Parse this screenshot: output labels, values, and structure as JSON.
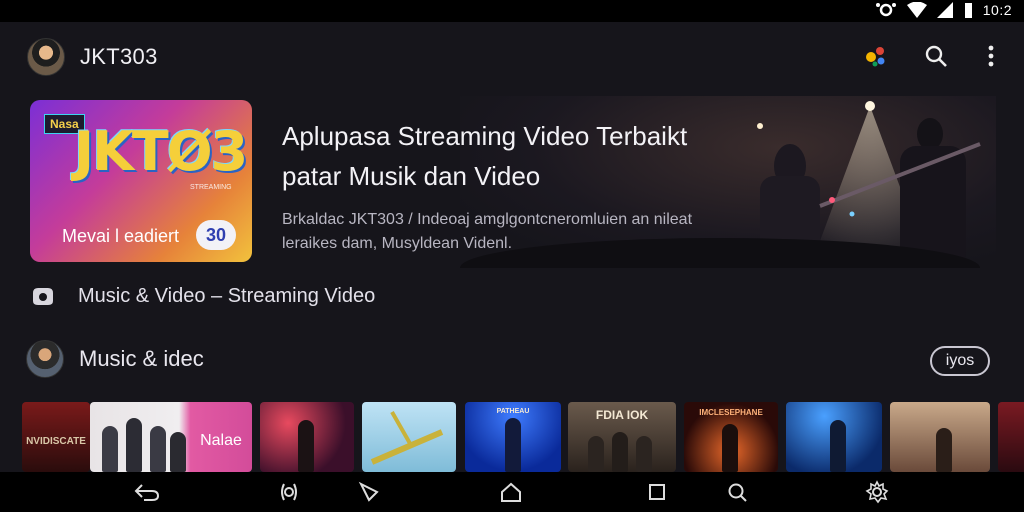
{
  "status_bar": {
    "time": "10:2",
    "icons": [
      "camera-icon",
      "wifi-icon",
      "cellular-icon",
      "battery-icon"
    ]
  },
  "header": {
    "title": "JKT303",
    "actions": [
      "assistant-icon",
      "search-icon",
      "more-vert-icon"
    ]
  },
  "hero": {
    "card_logo": "Nasa",
    "card_brand": "JKTØ3",
    "card_subtext": "STREAMING",
    "card_label": "Mevai l eadiert",
    "card_badge": "30",
    "title_line1": "Aplupasa Streaming Video Terbaikt",
    "title_line2": "patar Musik dan Video",
    "description_line1": "Brkaldac JKT303 / Indeoaj amglgontcneromluien an nileat",
    "description_line2": "leraikes dam, Musyldean Videnl."
  },
  "subtitle": {
    "text": "Music & Video  –  Streaming Video"
  },
  "shelf": {
    "title": "Music & idec",
    "pill": "iyos",
    "thumbnails": [
      {
        "caption": "NVIDISCATE"
      },
      {
        "caption": "Nalae"
      },
      {
        "caption": ""
      },
      {
        "caption": ""
      },
      {
        "caption": "PATHEAU"
      },
      {
        "caption": "FDIA IOK"
      },
      {
        "caption": "IMCLESEPHANE"
      },
      {
        "caption": ""
      },
      {
        "caption": ""
      }
    ]
  },
  "nav_bar": {
    "buttons": [
      "back-icon",
      "assistant-icon",
      "triangle-icon",
      "home-icon",
      "square-icon",
      "search-icon",
      "settings-icon"
    ]
  },
  "colors": {
    "background": "#16151b",
    "bars": "#000000",
    "badge_text": "#2f3fb0"
  }
}
